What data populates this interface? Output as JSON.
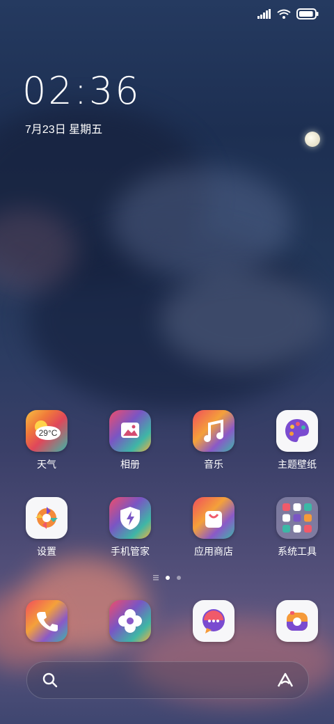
{
  "status_bar": {
    "signal_icon": "signal-icon",
    "wifi_icon": "wifi-icon",
    "battery_icon": "battery-icon",
    "battery_level": 0.85
  },
  "clock": {
    "time": "02:36",
    "date": "7月23日 星期五"
  },
  "apps_row1": [
    {
      "label": "天气",
      "icon": "weather-icon",
      "badge": "29°C"
    },
    {
      "label": "相册",
      "icon": "gallery-icon"
    },
    {
      "label": "音乐",
      "icon": "music-icon"
    },
    {
      "label": "主题壁纸",
      "icon": "palette-icon"
    }
  ],
  "apps_row2": [
    {
      "label": "设置",
      "icon": "settings-icon"
    },
    {
      "label": "手机管家",
      "icon": "security-shield-icon"
    },
    {
      "label": "应用商店",
      "icon": "app-store-bag-icon"
    },
    {
      "label": "系统工具",
      "icon": "folder-icon"
    }
  ],
  "page_indicator": {
    "current": 1,
    "pages": 2
  },
  "dock": [
    {
      "icon": "phone-icon"
    },
    {
      "icon": "browser-flower-icon"
    },
    {
      "icon": "messages-icon"
    },
    {
      "icon": "camera-icon"
    }
  ],
  "search_bar": {
    "search_icon": "search-icon",
    "assistant_icon": "assistant-icon"
  },
  "colors": {
    "sky_top": "#253a60",
    "sky_bottom": "#5d5680",
    "cloud_glow": "#e07a6a"
  }
}
